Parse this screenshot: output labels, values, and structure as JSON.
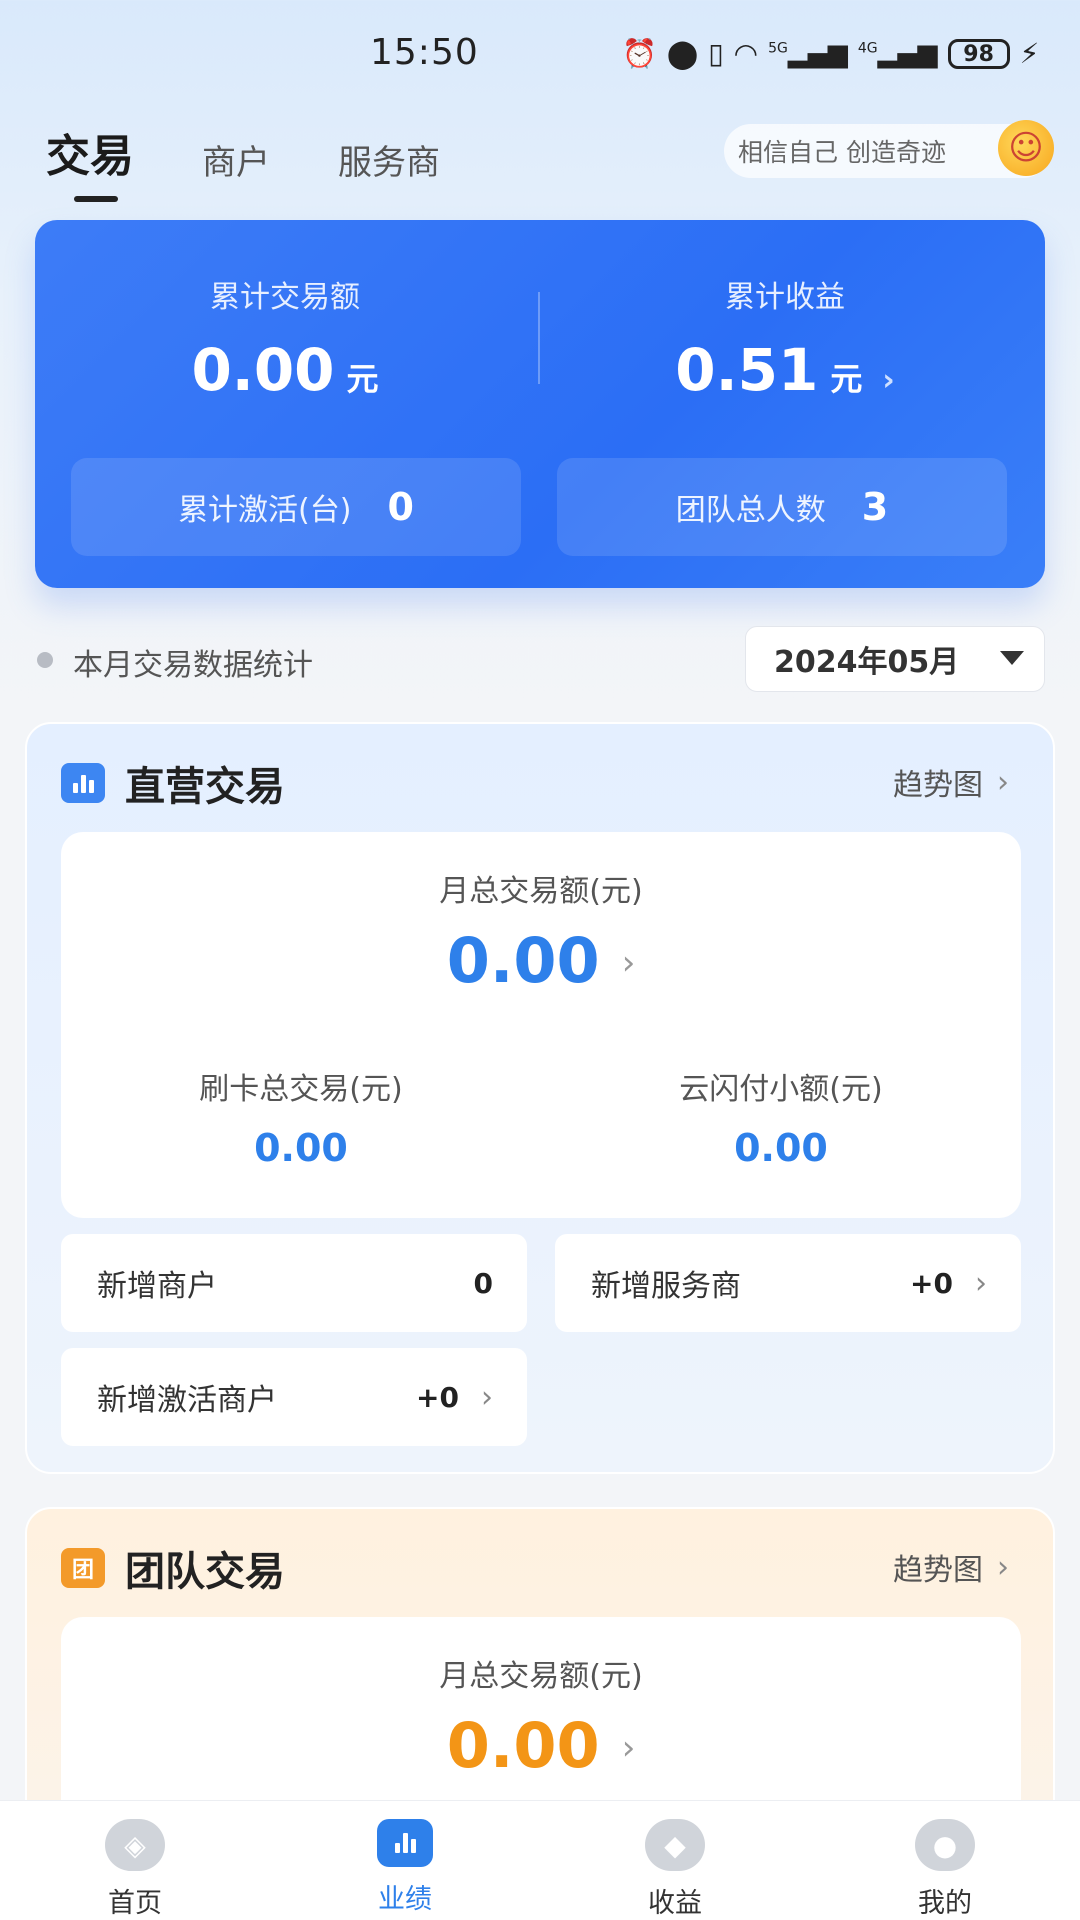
{
  "status_bar": {
    "time": "15:50",
    "signal_5g": "5G",
    "signal_4g": "4G",
    "battery": "98"
  },
  "top_tabs": [
    {
      "label": "交易",
      "active": true
    },
    {
      "label": "商户",
      "active": false
    },
    {
      "label": "服务商",
      "active": false
    }
  ],
  "motto": "相信自己 创造奇迹",
  "summary": {
    "total_trade_label": "累计交易额",
    "total_trade_value": "0.00",
    "total_trade_unit": "元",
    "total_income_label": "累计收益",
    "total_income_value": "0.51",
    "total_income_unit": "元",
    "activated_label": "累计激活(台)",
    "activated_value": "0",
    "team_label": "团队总人数",
    "team_value": "3",
    "accent_color": "#2b6ef5"
  },
  "month_stats": {
    "title": "本月交易数据统计",
    "selected_month": "2024年05月"
  },
  "direct": {
    "title": "直营交易",
    "trend_label": "趋势图",
    "month_total_label": "月总交易额(元)",
    "month_total_value": "0.00",
    "card_total_label": "刷卡总交易(元)",
    "card_total_value": "0.00",
    "cloud_pay_label": "云闪付小额(元)",
    "cloud_pay_value": "0.00",
    "new_merchant_label": "新增商户",
    "new_merchant_value": "0",
    "new_provider_label": "新增服务商",
    "new_provider_value": "+0",
    "new_activated_label": "新增激活商户",
    "new_activated_value": "+0",
    "accent_color": "#2e80ea"
  },
  "team": {
    "icon_text": "团",
    "title": "团队交易",
    "trend_label": "趋势图",
    "month_total_label": "月总交易额(元)",
    "month_total_value": "0.00",
    "accent_color": "#f39516"
  },
  "bottom_nav": [
    {
      "label": "首页",
      "icon": "home-icon",
      "active": false
    },
    {
      "label": "业绩",
      "icon": "performance-icon",
      "active": true
    },
    {
      "label": "收益",
      "icon": "income-icon",
      "active": false
    },
    {
      "label": "我的",
      "icon": "profile-icon",
      "active": false
    }
  ]
}
